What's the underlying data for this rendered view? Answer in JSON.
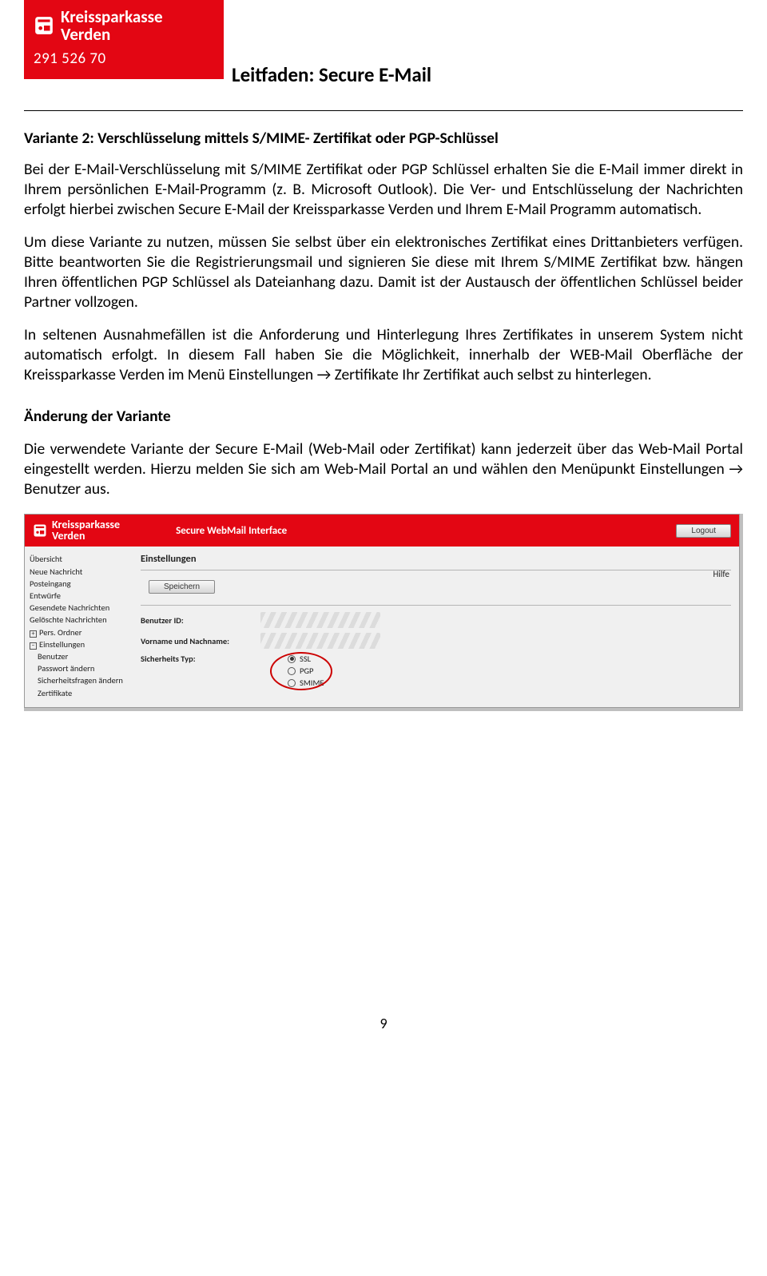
{
  "header": {
    "bank_name": "Kreissparkasse\nVerden",
    "bank_code": "291 526 70",
    "doc_title": "Leitfaden: Secure E-Mail"
  },
  "section": {
    "heading": "Variante 2: Verschlüsselung mittels S/MIME- Zertifikat oder PGP-Schlüssel",
    "p1": "Bei der E-Mail-Verschlüsselung mit S/MIME Zertifikat oder PGP Schlüssel erhalten Sie die E-Mail immer direkt in Ihrem persönlichen E-Mail-Programm (z. B. Microsoft Outlook). Die Ver- und Entschlüsselung der Nachrichten erfolgt hierbei zwischen Secure E-Mail der Kreissparkasse Verden und Ihrem E-Mail Programm automatisch.",
    "p2": "Um diese Variante zu nutzen, müssen Sie selbst über ein elektronisches Zertifikat eines Drittanbieters verfügen. Bitte beantworten Sie die Registrierungsmail und signieren Sie diese mit Ihrem S/MIME Zertifikat bzw. hängen Ihren öffentlichen PGP Schlüssel als Dateianhang dazu. Damit ist der Austausch der öffentlichen Schlüssel beider Partner vollzogen.",
    "p3": "In seltenen Ausnahmefällen ist die Anforderung und Hinterlegung Ihres Zertifikates in unserem System nicht automatisch erfolgt. In diesem Fall haben Sie die Möglichkeit, innerhalb der WEB-Mail Oberfläche der Kreissparkasse Verden im Menü Einstellungen → Zertifikate Ihr Zertifikat auch selbst zu hinterlegen.",
    "heading2": "Änderung der Variante",
    "p4": "Die verwendete Variante der Secure E-Mail (Web-Mail oder Zertifikat) kann jederzeit über das Web-Mail Portal eingestellt werden. Hierzu melden Sie sich am Web-Mail Portal an und wählen den Menüpunkt Einstellungen → Benutzer aus."
  },
  "webmail": {
    "bank_name": "Kreissparkasse\nVerden",
    "app_title": "Secure WebMail Interface",
    "logout": "Logout",
    "nav": [
      "Übersicht",
      "Neue Nachricht",
      "Posteingang",
      "Entwürfe",
      "Gesendete Nachrichten",
      "Gelöschte Nachrichten",
      "Pers. Ordner",
      "Einstellungen",
      "Benutzer",
      "Passwort ändern",
      "Sicherheitsfragen ändern",
      "Zertifikate"
    ],
    "panel_title": "Einstellungen",
    "help": "Hilfe",
    "save": "Speichern",
    "fld_userid": "Benutzer ID:",
    "fld_name": "Vorname und Nachname:",
    "fld_sectype": "Sicherheits Typ:",
    "opts": [
      "SSL",
      "PGP",
      "SMIME"
    ],
    "selected": "SSL"
  },
  "page_number": "9"
}
